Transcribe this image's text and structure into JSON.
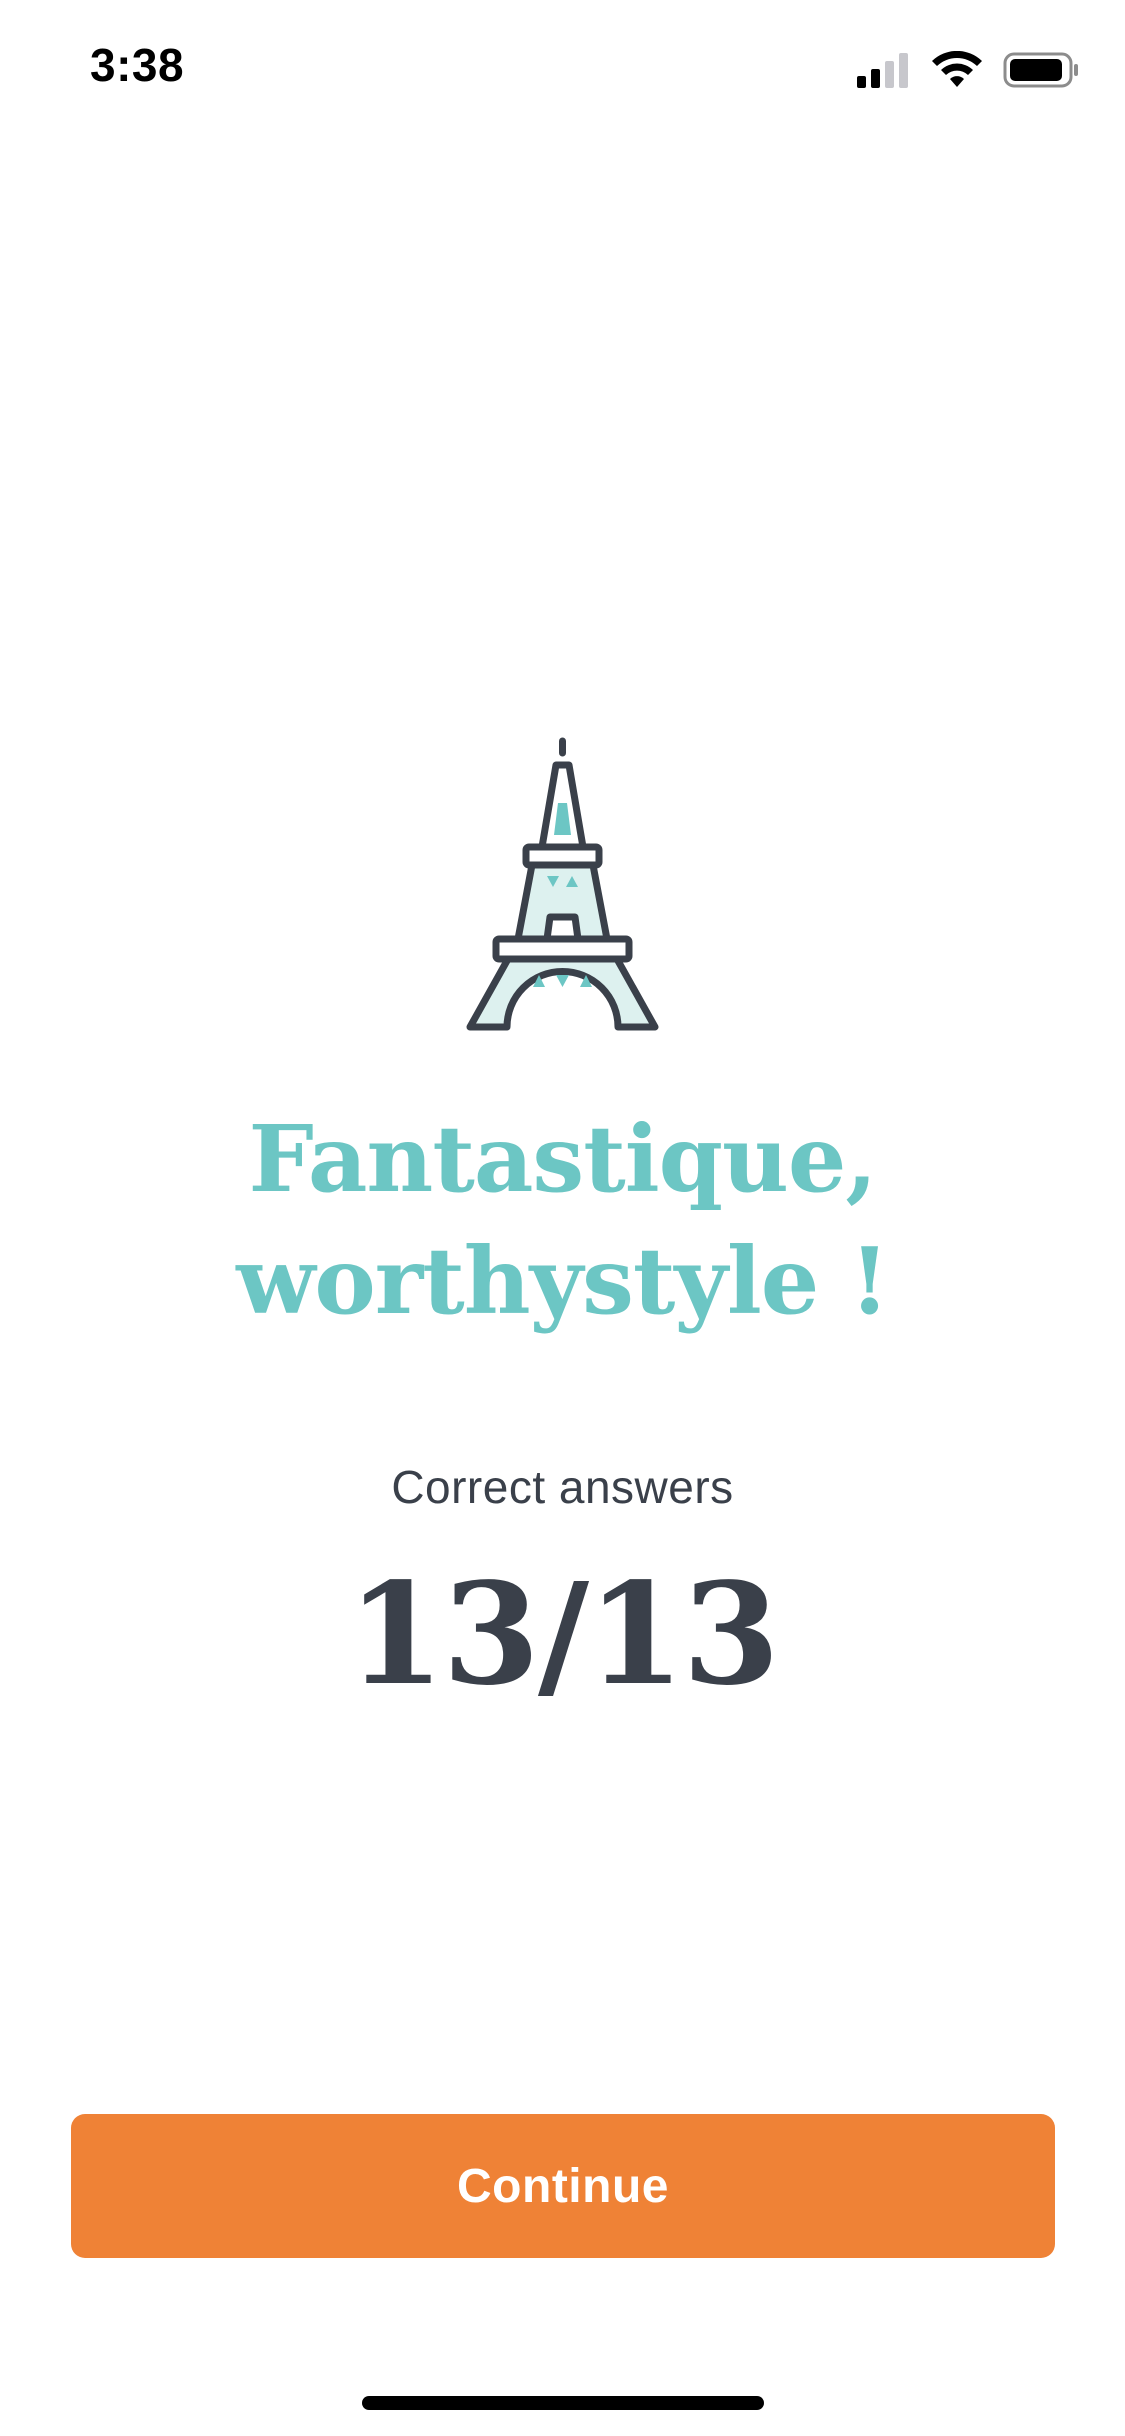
{
  "status_bar": {
    "time": "3:38",
    "icons": [
      "cellular-signal-icon",
      "wifi-icon",
      "battery-icon"
    ]
  },
  "result": {
    "illustration": "eiffel-tower-icon",
    "headline_line1": "Fantastique,",
    "headline_line2": "worthystyle !",
    "score_label": "Correct answers",
    "score_value": "13/13"
  },
  "actions": {
    "continue_label": "Continue"
  },
  "colors": {
    "accent_teal": "#6CC6C4",
    "text_dark": "#3A404A",
    "button_orange": "#EF8236",
    "background": "#FFFFFF"
  }
}
